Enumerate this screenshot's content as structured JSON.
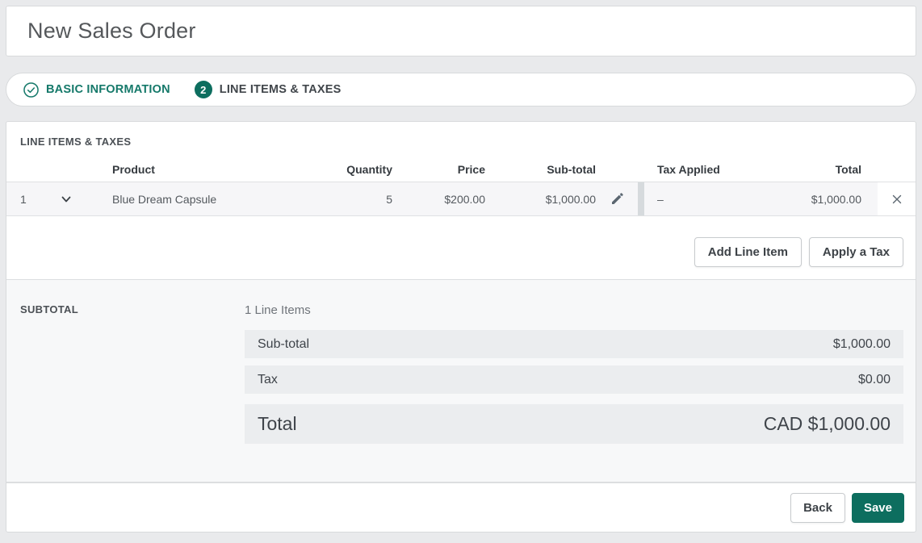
{
  "header": {
    "title": "New Sales Order"
  },
  "stepper": {
    "steps": [
      {
        "label": "BASIC INFORMATION",
        "state": "complete",
        "icon": "check-circle-icon"
      },
      {
        "label": "LINE ITEMS & TAXES",
        "state": "active",
        "number": "2"
      }
    ]
  },
  "line_items_section": {
    "title": "LINE ITEMS & TAXES",
    "table": {
      "headers": {
        "product": "Product",
        "quantity": "Quantity",
        "price": "Price",
        "subtotal": "Sub-total",
        "tax_applied": "Tax Applied",
        "total": "Total"
      },
      "rows": [
        {
          "index": "1",
          "product": "Blue Dream Capsule",
          "quantity": "5",
          "price": "$200.00",
          "subtotal": "$1,000.00",
          "tax_applied": "–",
          "total": "$1,000.00"
        }
      ]
    },
    "buttons": {
      "add_line_item": "Add Line Item",
      "apply_tax": "Apply a Tax"
    }
  },
  "subtotal_section": {
    "title": "SUBTOTAL",
    "line_items_count": "1 Line Items",
    "rows": [
      {
        "label": "Sub-total",
        "value": "$1,000.00"
      },
      {
        "label": "Tax",
        "value": "$0.00"
      }
    ],
    "total": {
      "label": "Total",
      "value": "CAD $1,000.00"
    }
  },
  "footer": {
    "back_label": "Back",
    "save_label": "Save"
  },
  "colors": {
    "accent_teal": "#0d6e5f",
    "teal_text": "#15796a",
    "page_background": "#e9eaec",
    "row_background": "#f6f6f8",
    "summary_row_background": "#ebedef"
  }
}
